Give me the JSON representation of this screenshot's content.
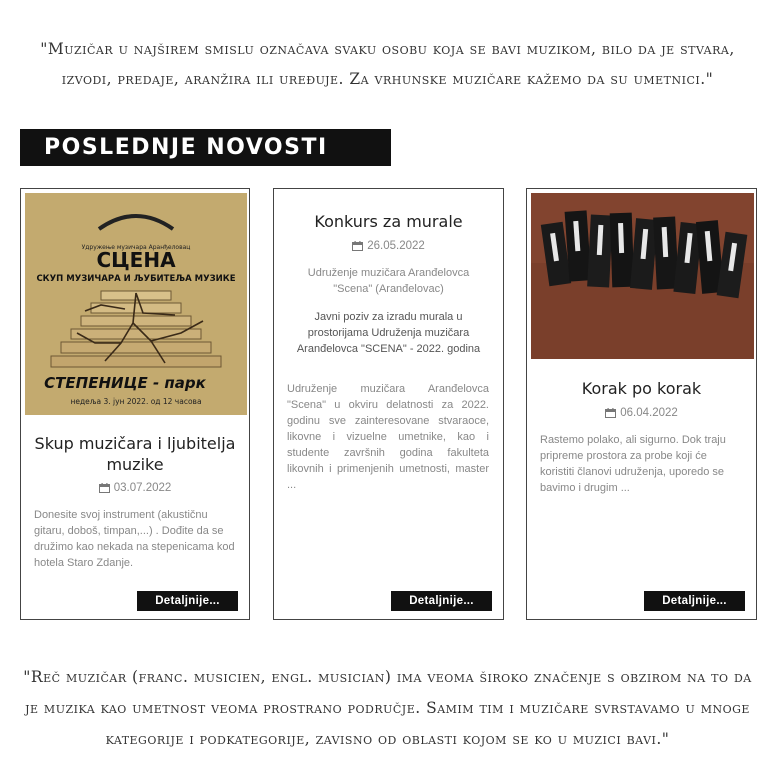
{
  "quote_top": "\"Muzičar u najširem smislu označava svaku osobu koja se bavi muzikom, bilo da je stvara, izvodi, predaje, aranžira ili uređuje. Za vrhunske muzičare kažemo da su umetnici.\"",
  "section_title": "POSLEDNJE NOVOSTI",
  "cards": [
    {
      "poster": {
        "org_small": "Удружење музичара Аранђеловац",
        "logo": "СЦЕНА",
        "subtitle": "СКУП МУЗИЧАРА И ЉУБИТЕЉА МУЗИКЕ",
        "place": "СТЕПЕНИЦЕ - парк",
        "when": "недеља 3. јун 2022. од 12 часова"
      },
      "title": "Skup muzičara i ljubitelja muzike",
      "date": "03.07.2022",
      "excerpt": "Donesite svoj instrument (akustičnu gitaru, doboš, timpan,...) . Dođite da se družimo kao nekada na stepenicama kod hotela Staro Zdanje.",
      "button": "Detaljnije..."
    },
    {
      "title": "Konkurs za murale",
      "date": "26.05.2022",
      "org": "Udruženje muzičara Aranđelovca \"Scena\" (Aranđelovac)",
      "lead": "Javni poziv za izradu murala u prostorijama Udruženja muzičara Aranđelovca \"SCENA\" - 2022. godina",
      "excerpt": "Udruženje muzičara Aranđelovca \"Scena\" u okviru delatnosti za 2022. godinu sve zainteresovane stvaraoce, likovne i vizuelne umetnike, kao i studente završnih godina fakulteta likovnih i primenjenih umetnosti, master ...",
      "button": "Detaljnije..."
    },
    {
      "title": "Korak po korak",
      "date": "06.04.2022",
      "excerpt": "Rastemo polako, ali sigurno. Dok traju pripreme prostora za probe koji će koristiti članovi udruženja, uporedo se bavimo i drugim ...",
      "button": "Detaljnije..."
    }
  ],
  "quote_bottom": "\"Reč muzičar (franc. musicien, engl. musician) ima veoma široko značenje s obzirom na to da je muzika kao umetnost veoma prostrano područje. Samim tim i muzičare svrstavamo u mnoge kategorije i podkategorije, zavisno od oblasti kojom se ko u muzici bavi.\""
}
